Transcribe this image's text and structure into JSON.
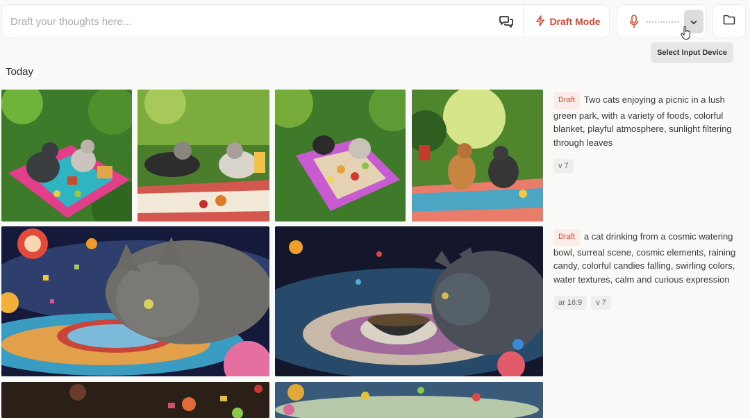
{
  "composer": {
    "placeholder": "Draft your thoughts here...",
    "draft_mode_label": "Draft Mode",
    "tooltip": "Select Input Device"
  },
  "icons": {
    "chat": "chat-bubbles-icon",
    "bolt": "lightning-icon",
    "mic": "microphone-icon",
    "chevron": "chevron-down-icon",
    "folder": "folder-icon",
    "cursor": "hand-pointer-icon"
  },
  "colors": {
    "accent": "#d64a35",
    "badge_bg": "#fbece9",
    "page_bg": "#f9f9f8"
  },
  "feed": {
    "section_title": "Today",
    "jobs": [
      {
        "badge": "Draft",
        "prompt": "Two cats enjoying a picnic in a lush green park, with a variety of foods, colorful blanket, playful atmosphere, sunlight filtering through leaves",
        "params": [
          "v 7"
        ]
      },
      {
        "badge": "Draft",
        "prompt": "a cat drinking from a cosmic watering bowl, surreal scene, cosmic elements, raining candy, colorful candies falling, swirling colors, water textures, calm and curious expression",
        "params": [
          "ar 16:9",
          "v 7"
        ]
      }
    ]
  }
}
